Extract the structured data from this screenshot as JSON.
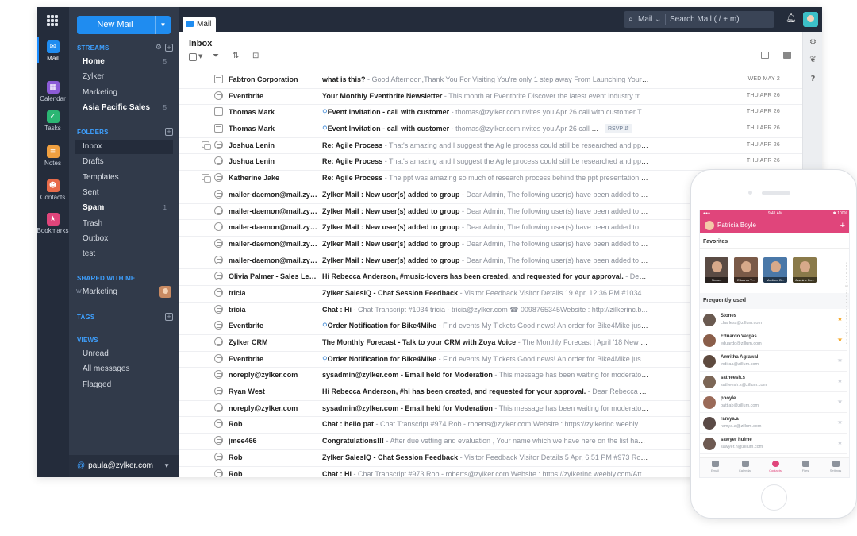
{
  "rail": {
    "items": [
      {
        "label": "Mail",
        "icon": "mail-icon",
        "color": "#1f8cf0"
      },
      {
        "label": "Calendar",
        "icon": "calendar-icon",
        "color": "#8b5bd6"
      },
      {
        "label": "Tasks",
        "icon": "tasks-icon",
        "color": "#2bb673"
      },
      {
        "label": "Notes",
        "icon": "notes-icon",
        "color": "#f0a040"
      },
      {
        "label": "Contacts",
        "icon": "contacts-icon",
        "color": "#e86b4a"
      },
      {
        "label": "Bookmarks",
        "icon": "bookmarks-icon",
        "color": "#e0457b"
      }
    ]
  },
  "folders": {
    "new_mail": "New Mail",
    "streams_head": "STREAMS",
    "streams": [
      {
        "label": "Home",
        "count": "5"
      },
      {
        "label": "Zylker",
        "count": ""
      },
      {
        "label": "Marketing",
        "count": ""
      },
      {
        "label": "Asia Pacific Sales",
        "count": "5"
      }
    ],
    "folders_head": "FOLDERS",
    "items": [
      {
        "label": "Inbox",
        "count": ""
      },
      {
        "label": "Drafts",
        "count": ""
      },
      {
        "label": "Templates",
        "count": ""
      },
      {
        "label": "Sent",
        "count": ""
      },
      {
        "label": "Spam",
        "count": "1"
      },
      {
        "label": "Trash",
        "count": ""
      },
      {
        "label": "Outbox",
        "count": ""
      },
      {
        "label": "test",
        "count": ""
      }
    ],
    "shared_head": "SHARED WITH ME",
    "shared_prefix": "W",
    "shared_item": "Marketing",
    "tags_head": "TAGS",
    "views_head": "VIEWS",
    "views": [
      "Unread",
      "All messages",
      "Flagged"
    ],
    "account": "paula@zylker.com"
  },
  "topbar": {
    "tab": "Mail",
    "search_scope": "Mail",
    "search_placeholder": "Search Mail  ( / + m)"
  },
  "mail": {
    "title": "Inbox",
    "rows": [
      {
        "from": "Fabtron Corporation",
        "subject": "what is this?",
        "preview": " - Good Afternoon,Thank You For Visiting You're only 1 step away From Launching Your B...",
        "date": "WED MAY 2",
        "icon": "cal",
        "thread": false,
        "clip": false,
        "rsvp": ""
      },
      {
        "from": "Eventbrite",
        "subject": "Your Monthly Eventbrite Newsletter",
        "preview": " - This month at Eventbrite Discover the latest event industry tre...",
        "date": "THU APR 26",
        "icon": "env",
        "thread": false,
        "clip": false,
        "rsvp": ""
      },
      {
        "from": "Thomas Mark",
        "subject": "Event Invitation - call with customer",
        "preview": " - thomas@zylker.comInvites you Apr 26 call with customer Thu ...",
        "date": "THU APR 26",
        "icon": "cal",
        "thread": false,
        "clip": true,
        "rsvp": ""
      },
      {
        "from": "Thomas Mark",
        "subject": "Event Invitation - call with customer",
        "preview": " - thomas@zylker.comInvites you Apr 26 call with custc",
        "date": "THU APR 26",
        "icon": "cal",
        "thread": false,
        "clip": true,
        "rsvp": "RSVP ⇵"
      },
      {
        "from": "Joshua Lenin",
        "subject": "Re: Agile Process",
        "preview": " - That's amazing and I suggest the Agile process could still be researched and ppt coul...",
        "date": "THU APR 26",
        "icon": "env",
        "thread": true,
        "clip": false,
        "rsvp": ""
      },
      {
        "from": "Joshua Lenin",
        "subject": "Re: Agile Process",
        "preview": " - That's amazing and I suggest the Agile process could still be researched and ppt coul...",
        "date": "THU APR 26",
        "icon": "env",
        "thread": false,
        "clip": false,
        "rsvp": ""
      },
      {
        "from": "Katherine Jake",
        "subject": "Re: Agile Process",
        "preview": " - The ppt was amazing so much of research process behind the ppt presentation and ...",
        "date": "THU APR 26",
        "icon": "env",
        "thread": true,
        "clip": false,
        "rsvp": ""
      },
      {
        "from": "mailer-daemon@mail.zyl...",
        "subject": "Zylker Mail : New user(s) added to group",
        "preview": " - Dear Admin, The following user(s) have been added to the gr...",
        "date": "",
        "icon": "env",
        "thread": false,
        "clip": false,
        "rsvp": ""
      },
      {
        "from": "mailer-daemon@mail.zyl...",
        "subject": "Zylker Mail : New user(s) added to group",
        "preview": " - Dear Admin, The following user(s) have been added to the gr...",
        "date": "",
        "icon": "env",
        "thread": false,
        "clip": false,
        "rsvp": ""
      },
      {
        "from": "mailer-daemon@mail.zyl...",
        "subject": "Zylker Mail : New user(s) added to group",
        "preview": " - Dear Admin, The following user(s) have been added to the gr...",
        "date": "",
        "icon": "env",
        "thread": false,
        "clip": false,
        "rsvp": ""
      },
      {
        "from": "mailer-daemon@mail.zyl...",
        "subject": "Zylker Mail : New user(s) added to group",
        "preview": " - Dear Admin, The following user(s) have been added to the gr...",
        "date": "",
        "icon": "env",
        "thread": false,
        "clip": false,
        "rsvp": ""
      },
      {
        "from": "mailer-daemon@mail.zyl...",
        "subject": "Zylker Mail : New user(s) added to group",
        "preview": " - Dear Admin, The following user(s) have been added to the gr...",
        "date": "",
        "icon": "env",
        "thread": false,
        "clip": false,
        "rsvp": ""
      },
      {
        "from": "Olivia Palmer - Sales Lead",
        "subject": "Hi Rebecca Anderson, #music-lovers has been created, and requested for your approval.",
        "preview": " - Dear Rebecc...",
        "date": "",
        "icon": "env",
        "thread": false,
        "clip": false,
        "rsvp": ""
      },
      {
        "from": "tricia",
        "subject": "Zylker SalesIQ - Chat Session Feedback",
        "preview": " - Visitor Feedback Visitor Details 19 Apr, 12:36 PM #1034 tric...",
        "date": "",
        "icon": "env",
        "thread": false,
        "clip": false,
        "rsvp": ""
      },
      {
        "from": "tricia",
        "subject": "Chat : Hi",
        "preview": " - Chat Transcript #1034 tricia - tricia@zylker.com ☎ 0098765345Website : http://zilkerinc.b...",
        "date": "",
        "icon": "env",
        "thread": false,
        "clip": false,
        "rsvp": ""
      },
      {
        "from": "Eventbrite",
        "subject": "Order Notification for Bike4Mike",
        "preview": " - Find events My Tickets Good news! An order for Bike4Mike just ...",
        "date": "",
        "icon": "env",
        "thread": false,
        "clip": true,
        "rsvp": ""
      },
      {
        "from": "Zylker CRM",
        "subject": "The Monthly Forecast - Talk to your CRM with Zoya Voice",
        "preview": " - The Monthly Forecast | April '18 New feat...",
        "date": "",
        "icon": "env",
        "thread": false,
        "clip": false,
        "rsvp": ""
      },
      {
        "from": "Eventbrite",
        "subject": "Order Notification for Bike4Mike",
        "preview": " - Find events My Tickets Good news! An order for Bike4Mike just ...",
        "date": "",
        "icon": "env",
        "thread": false,
        "clip": true,
        "rsvp": ""
      },
      {
        "from": "noreply@zylker.com",
        "subject": "sysadmin@zylker.com - Email held for Moderation",
        "preview": " - This message has been waiting for moderator appr...",
        "date": "",
        "icon": "env",
        "thread": false,
        "clip": false,
        "rsvp": ""
      },
      {
        "from": "Ryan West",
        "subject": "Hi Rebecca Anderson, #hi has been created, and requested for your approval.",
        "preview": " - Dear Rebecca Anderso...",
        "date": "",
        "icon": "env",
        "thread": false,
        "clip": false,
        "rsvp": ""
      },
      {
        "from": "noreply@zylker.com",
        "subject": "sysadmin@zylker.com - Email held for Moderation",
        "preview": " - This message has been waiting for moderator appr...",
        "date": "",
        "icon": "env",
        "thread": false,
        "clip": false,
        "rsvp": ""
      },
      {
        "from": "Rob",
        "subject": "Chat : hello pat",
        "preview": " - Chat Transcript #974 Rob - roberts@zylker.com Website : https://zylkerinc.weebly.co...",
        "date": "",
        "icon": "env",
        "thread": false,
        "clip": false,
        "rsvp": ""
      },
      {
        "from": "jmee466",
        "subject": "Congratulations!!!",
        "preview": " - After due vetting and evaluation , Your name which we have here on the list happe...",
        "date": "",
        "icon": "env",
        "thread": false,
        "clip": false,
        "rsvp": ""
      },
      {
        "from": "Rob",
        "subject": "Zylker SalesIQ - Chat Session Feedback",
        "preview": " - Visitor Feedback Visitor Details 5 Apr, 6:51 PM #973 Rob Em...",
        "date": "",
        "icon": "env",
        "thread": false,
        "clip": false,
        "rsvp": ""
      },
      {
        "from": "Rob",
        "subject": "Chat : Hi",
        "preview": " - Chat Transcript #973 Rob - roberts@zylker.com Website : https://zylkerinc.weebly.com/Att...",
        "date": "",
        "icon": "env",
        "thread": false,
        "clip": false,
        "rsvp": ""
      }
    ]
  },
  "phone": {
    "status_time": "9:41 AM",
    "status_battery": "✱ 100%",
    "status_carrier": "●●●",
    "header_name": "Patricia Boyle",
    "favorites_head": "Favorites",
    "favorites": [
      {
        "name": "Stones",
        "color": "#5a4b44"
      },
      {
        "name": "Eduardo V...",
        "color": "#7a5a48"
      },
      {
        "name": "Madison B...",
        "color": "#4a78a8"
      },
      {
        "name": "Jasmine Fa...",
        "color": "#8a7a4a"
      }
    ],
    "frequent_head": "Frequently used",
    "contacts": [
      {
        "name": "Stones",
        "email": "charless@zillum.com",
        "starred": true
      },
      {
        "name": "Eduardo Vargas",
        "email": "eduardo@zillum.com",
        "starred": true
      },
      {
        "name": "Amritha Agrawal",
        "email": "indiraa@zillum.com",
        "starred": false
      },
      {
        "name": "satheesh.s",
        "email": "satheesh.s@zillum.com",
        "starred": false
      },
      {
        "name": "pboyle",
        "email": "pattiab@zillum.com",
        "starred": false
      },
      {
        "name": "ramya.a",
        "email": "ramya.a@zillum.com",
        "starred": false
      },
      {
        "name": "sawyer hulme",
        "email": "sawyer.h@zillum.com",
        "starred": false
      }
    ],
    "tabs": [
      "Email",
      "Calendar",
      "Contacts",
      "Files",
      "Settings"
    ],
    "active_tab": "Contacts"
  }
}
